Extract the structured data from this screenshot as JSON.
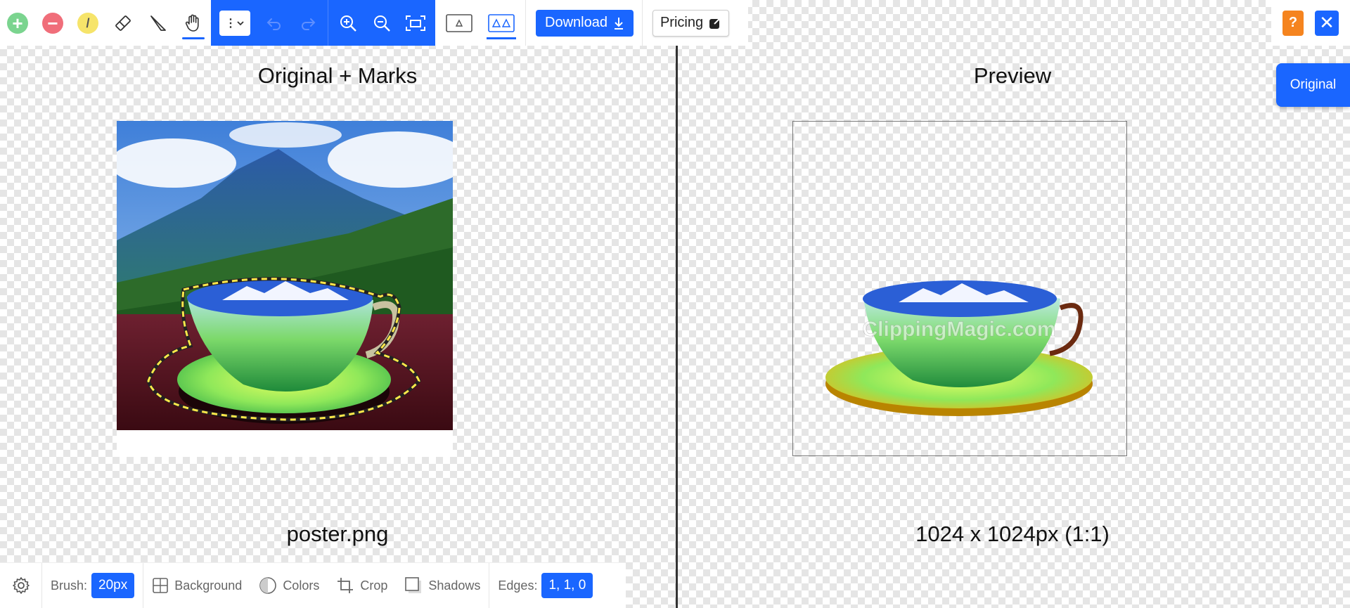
{
  "toolbar": {
    "tools": [
      {
        "name": "keep-tool",
        "icon": "plus-circle-icon"
      },
      {
        "name": "remove-tool",
        "icon": "minus-circle-icon"
      },
      {
        "name": "hair-tool",
        "icon": "slash-circle-icon"
      },
      {
        "name": "eraser-tool",
        "icon": "eraser-icon"
      },
      {
        "name": "scalpel-tool",
        "icon": "scalpel-icon"
      },
      {
        "name": "pan-tool",
        "icon": "hand-icon",
        "active": true
      }
    ],
    "menu_glyph": "⋮",
    "download_label": "Download",
    "pricing_label": "Pricing"
  },
  "top_right": {
    "help_label": "?",
    "close_label": "✕"
  },
  "original_button_label": "Original",
  "left_panel": {
    "title": "Original + Marks",
    "filename": "poster.png"
  },
  "right_panel": {
    "title": "Preview",
    "watermark": "ClippingMagic.com",
    "dimensions": "1024 x 1024px (1:1)"
  },
  "bottom_toolbar": {
    "brush_label": "Brush:",
    "brush_value": "20px",
    "background_label": "Background",
    "colors_label": "Colors",
    "crop_label": "Crop",
    "shadows_label": "Shadows",
    "edges_label": "Edges:",
    "edges_value": "1, 1, 0"
  },
  "colors": {
    "accent": "#1a66ff",
    "help": "#f5841f"
  }
}
